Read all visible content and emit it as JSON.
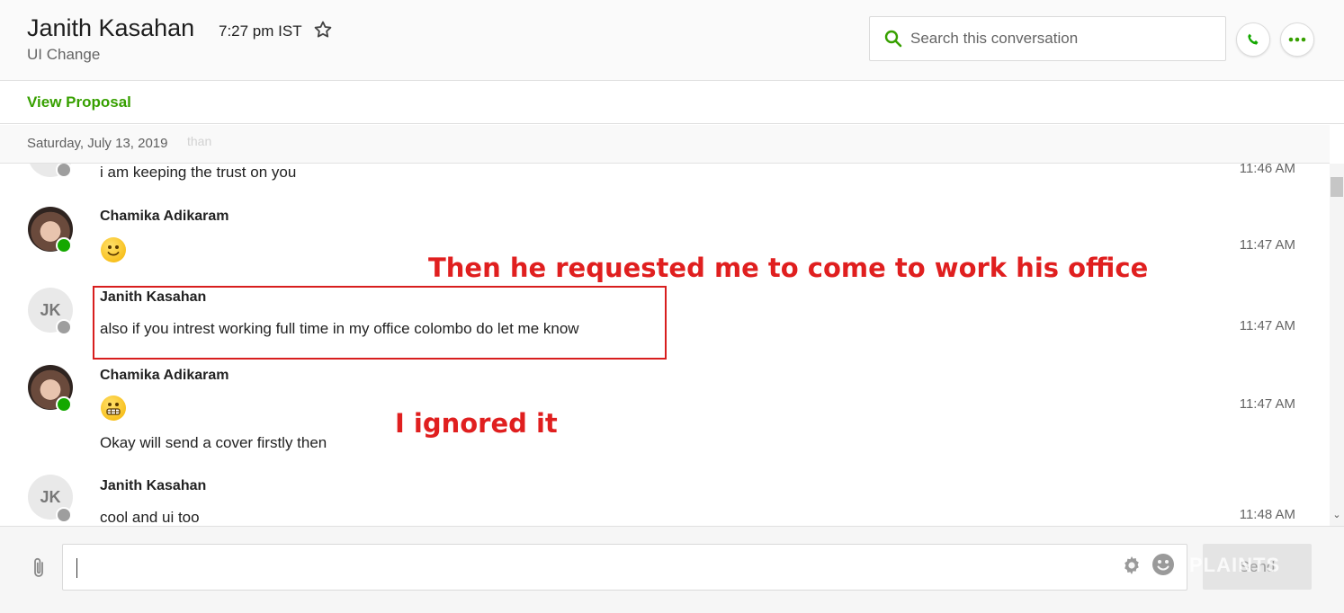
{
  "header": {
    "contact_name": "Janith Kasahan",
    "local_time": "7:27 pm IST",
    "subtitle": "UI Change",
    "search_placeholder": "Search this conversation"
  },
  "proposal": {
    "link_label": "View Proposal"
  },
  "conversation": {
    "date_divider": "Saturday, July 13, 2019",
    "ghost_sender": "than",
    "messages": [
      {
        "sender": "",
        "text": "i am keeping the trust on you",
        "time": "11:46 AM",
        "avatar": "JK",
        "status": "offline"
      },
      {
        "sender": "Chamika Adikaram",
        "emoji": "slightly-smiling-face",
        "text": "",
        "time": "11:47 AM",
        "avatar": "photo",
        "status": "online"
      },
      {
        "sender": "Janith Kasahan",
        "text": "also if you intrest working full time in my office colombo do let me know",
        "time": "11:47 AM",
        "avatar": "JK",
        "status": "offline"
      },
      {
        "sender": "Chamika Adikaram",
        "emoji": "grimacing-face",
        "text": "Okay will send a cover firstly then",
        "time": "11:47 AM",
        "avatar": "photo",
        "status": "online"
      },
      {
        "sender": "Janith Kasahan",
        "text": "cool and ui too",
        "time": "11:48 AM",
        "avatar": "JK",
        "status": "offline"
      }
    ]
  },
  "compose": {
    "send_label": "Send",
    "watermark": "PLAINTS"
  },
  "annotations": {
    "note_1": "Then he requested me to come to work his office",
    "note_2": "I ignored it"
  },
  "colors": {
    "accent_green": "#37a000",
    "online_green": "#14a800",
    "annotation_red": "#e01f1f"
  }
}
